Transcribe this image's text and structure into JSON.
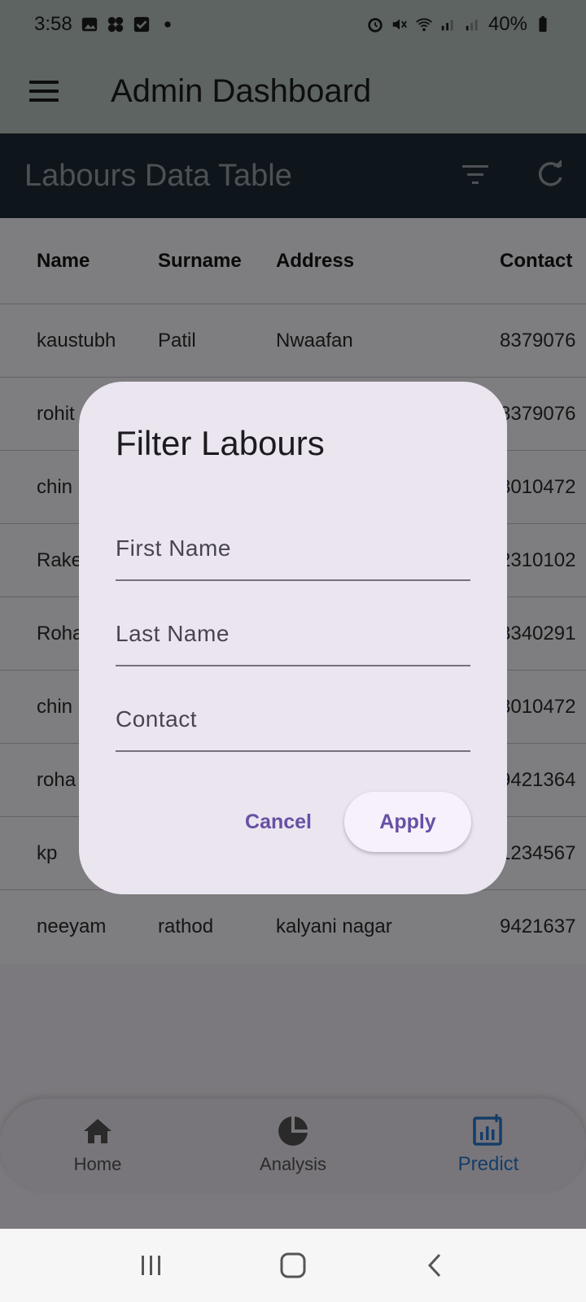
{
  "status_bar": {
    "time": "3:58",
    "battery": "40%"
  },
  "app_bar": {
    "title": "Admin Dashboard"
  },
  "table_section": {
    "title": "Labours Data Table"
  },
  "table": {
    "columns": [
      "Name",
      "Surname",
      "Address",
      "Contact"
    ],
    "rows": [
      [
        "kaustubh",
        "Patil",
        "Nwaafan",
        "8379076"
      ],
      [
        "rohit",
        "",
        "",
        "8379076"
      ],
      [
        "chin",
        "",
        "",
        "8010472"
      ],
      [
        "Rake",
        "",
        "",
        "2310102"
      ],
      [
        "Roha",
        "",
        "",
        "8340291"
      ],
      [
        "chin",
        "",
        "",
        "8010472"
      ],
      [
        "roha",
        "",
        "",
        "9421364"
      ],
      [
        "kp",
        "",
        "",
        "1234567"
      ],
      [
        "neeyam",
        "rathod",
        "kalyani nagar",
        "9421637"
      ]
    ]
  },
  "dialog": {
    "title": "Filter Labours",
    "fields": {
      "first_name": {
        "placeholder": "First Name",
        "value": ""
      },
      "last_name": {
        "placeholder": "Last Name",
        "value": ""
      },
      "contact": {
        "placeholder": "Contact",
        "value": ""
      }
    },
    "cancel_label": "Cancel",
    "apply_label": "Apply"
  },
  "bottom_nav": {
    "items": [
      {
        "label": "Home",
        "icon": "home-icon"
      },
      {
        "label": "Analysis",
        "icon": "pie-chart-icon"
      },
      {
        "label": "Predict",
        "icon": "analytics-icon",
        "active": true
      }
    ]
  },
  "colors": {
    "accent": "#6750a4",
    "nav_active": "#2b7bd0",
    "table_bar": "#1d2b36"
  }
}
